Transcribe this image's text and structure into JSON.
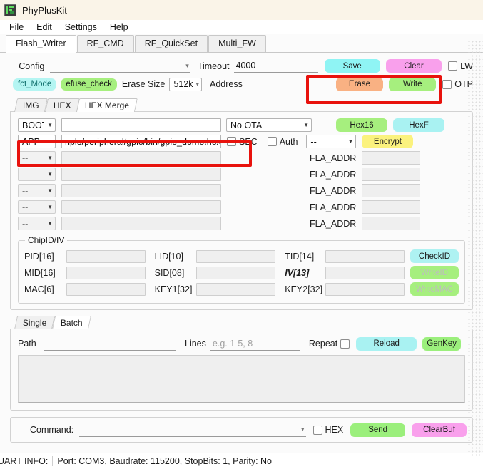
{
  "window": {
    "title": "PhyPlusKit",
    "icon": "app-icon"
  },
  "menu": {
    "items": [
      {
        "label": "File"
      },
      {
        "label": "Edit"
      },
      {
        "label": "Settings"
      },
      {
        "label": "Help"
      }
    ]
  },
  "tabs": [
    {
      "label": "Flash_Writer",
      "active": true
    },
    {
      "label": "RF_CMD",
      "active": false
    },
    {
      "label": "RF_QuickSet",
      "active": false
    },
    {
      "label": "Multi_FW",
      "active": false
    }
  ],
  "config_row": {
    "config_label": "Config",
    "config_value": "",
    "timeout_label": "Timeout",
    "timeout_value": "4000",
    "save_label": "Save",
    "clear_label": "Clear",
    "lw_label": "LW",
    "lw_checked": false
  },
  "mode_row": {
    "fct_mode_label": "fct_Mode",
    "efuse_check_label": "efuse_check",
    "erase_size_label": "Erase Size",
    "erase_size_value": "512k",
    "address_label": "Address",
    "address_value": "",
    "erase_label": "Erase",
    "write_label": "Write",
    "otp_label": "OTP",
    "otp_checked": false
  },
  "image_tabs": [
    {
      "label": "IMG",
      "active": false
    },
    {
      "label": "HEX",
      "active": false
    },
    {
      "label": "HEX Merge",
      "active": true
    }
  ],
  "merge": {
    "rows": [
      {
        "type": "BOOT",
        "path": "",
        "addr_label": "",
        "addr_value": "",
        "enabled": true
      },
      {
        "type": "APP",
        "path": "nple/peripheral/gpio/bin/gpio_demo.hex",
        "addr_label": "",
        "addr_value": "",
        "enabled": true
      },
      {
        "type": "--",
        "path": "",
        "addr_label": "FLA_ADDR",
        "addr_value": "",
        "enabled": false
      },
      {
        "type": "--",
        "path": "",
        "addr_label": "FLA_ADDR",
        "addr_value": "",
        "enabled": false
      },
      {
        "type": "--",
        "path": "",
        "addr_label": "FLA_ADDR",
        "addr_value": "",
        "enabled": false
      },
      {
        "type": "--",
        "path": "",
        "addr_label": "FLA_ADDR",
        "addr_value": "",
        "enabled": false
      },
      {
        "type": "--",
        "path": "",
        "addr_label": "FLA_ADDR",
        "addr_value": "",
        "enabled": false
      }
    ],
    "ota_value": "No OTA",
    "hex16_label": "Hex16",
    "hexf_label": "HexF",
    "sec_label": "SEC",
    "sec_checked": false,
    "auth_label": "Auth",
    "auth_checked": false,
    "encrypt_select_value": "--",
    "encrypt_label": "Encrypt"
  },
  "chipid": {
    "group_title": "ChipID/IV",
    "fields": [
      {
        "label": "PID[16]",
        "value": ""
      },
      {
        "label": "LID[10]",
        "value": ""
      },
      {
        "label": "TID[14]",
        "value": ""
      },
      {
        "label": "MID[16]",
        "value": ""
      },
      {
        "label": "SID[08]",
        "value": ""
      },
      {
        "label": "IV[13]",
        "value": ""
      },
      {
        "label": "MAC[6]",
        "value": ""
      },
      {
        "label": "KEY1[32]",
        "value": ""
      },
      {
        "label": "KEY2[32]",
        "value": ""
      }
    ],
    "check_id_label": "CheckID",
    "write_id_label": "WriteID",
    "write_mac_label": "WriteMAC"
  },
  "batch_tabs": [
    {
      "label": "Single",
      "active": false
    },
    {
      "label": "Batch",
      "active": true
    }
  ],
  "batch": {
    "path_label": "Path",
    "path_value": "",
    "lines_label": "Lines",
    "lines_value": "",
    "lines_placeholder": "e.g. 1-5, 8",
    "repeat_label": "Repeat",
    "repeat_checked": false,
    "reload_label": "Reload",
    "genkey_label": "GenKey",
    "log_value": ""
  },
  "command_bar": {
    "label": "Command:",
    "value": "",
    "hex_label": "HEX",
    "hex_checked": false,
    "send_label": "Send",
    "clearbuf_label": "ClearBuf"
  },
  "statusbar": {
    "prefix": "UART INFO:",
    "info": "Port: COM3, Baudrate: 115200, StopBits: 1, Parity: No"
  },
  "colors": {
    "save": "#8ff4f4",
    "clear": "#f9a0ec",
    "erase": "#f9b183",
    "write": "#a6ef7e",
    "fct_mode": "#b4f5f2",
    "efuse_check": "#a6ef7e",
    "hex16": "#a6ef7e",
    "hexf": "#a9f2f2",
    "encrypt": "#fbf27e",
    "checkid": "#aef2f2",
    "writeid": "#a6ef7e",
    "writemac": "#a6ef7e",
    "reload": "#a9f2f2",
    "genkey": "#9bef7c",
    "send": "#9bef7c",
    "clearbuf": "#f9a0ec",
    "annotation": "#e8120d"
  }
}
